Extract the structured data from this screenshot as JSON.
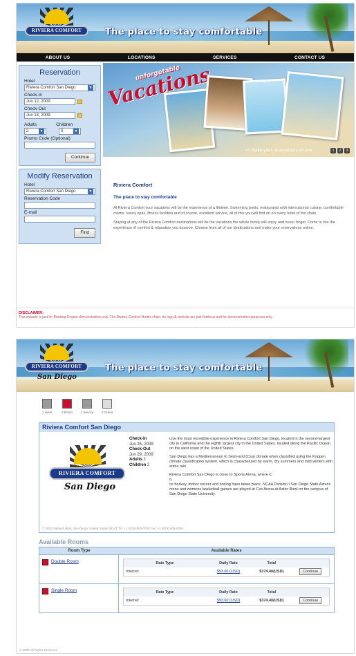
{
  "brand": {
    "name": "RIVIERA COMFORT",
    "tagline": "The place to stay comfortable",
    "city": "San Diego"
  },
  "nav": [
    "ABOUT US",
    "LOCATIONS",
    "SERVICES",
    "CONTACT US"
  ],
  "reservation": {
    "title": "Reservation",
    "hotel_label": "Hotel",
    "hotel_value": "Riviera Comfort San Diego",
    "checkin_label": "Check-In",
    "checkin_value": "Jun 12, 2009",
    "checkout_label": "Check-Out",
    "checkout_value": "Jun 13, 2009",
    "adults_label": "Adults",
    "adults_value": "2",
    "children_label": "Children",
    "children_value": "0",
    "promo_label": "Promo Code (Optional)",
    "continue": "Continue"
  },
  "modify": {
    "title": "Modify Reservation",
    "hotel_label": "Hotel",
    "hotel_value": "Riviera Comfort San Diego",
    "code_label": "Reservation Code",
    "email_label": "E-mail",
    "find": "Find"
  },
  "banner": {
    "unforgettable": "unforgetable",
    "vacations": "Vacations",
    "cta": ">> Make your reservations on-line",
    "pages": [
      "1",
      "2",
      "3"
    ]
  },
  "content": {
    "heading": "Riviera Comfort",
    "subheading": "The place to stay comfortable",
    "p1": "At Riviera Comfort your vacations will be the experience of a lifetime. Swimming pools, restaurants with international cuisine, comfortable rooms, luxury spas, fitness facilities and of course, excellent service, all of this you will find on on every hotel of the chain.",
    "p2": "Staying at any of the Riviera Comfort destinations will be the vacations the whole family will enjoy and never forget. Come to live the experience of comfort & relaxation you deserve. Choose from all of our destinations and make your reservations online."
  },
  "disclaimer": {
    "title": "DISCLAIMER:",
    "text": "This website is just for Booking Engine demonstration only. The Riviera Comfort Hotels chain, its logo & website are just fictitious and for demonstration purposes only."
  },
  "steps": [
    "1 Hotel",
    "2 Room",
    "3 Service",
    "4 Guest"
  ],
  "hotel": {
    "title": "Riviera Comfort San Diego",
    "checkin_label": "Check-In",
    "checkin": "Jun 25, 2009",
    "checkout_label": "Check-Out",
    "checkout": "Jun 29, 2009",
    "adults_label": "Adults",
    "adults": "2",
    "children_label": "Children",
    "children": "2",
    "d1": "Live the most incredible experience in Riviera Comfort San Diego, located in the second-largest city in California and the eighth largest city in the United States, located along the Pacific Ocean on the west coast of the United States.",
    "d2": "San Diego has a Mediterranean to Semi-arid (Csa) climate when classified using the Koppen climate classification system, which is characterized by warm, dry summers and mild winters with some rain.",
    "d3": "Riviera Comfort San Diego is close to Sports Arena, where ic",
    "d4": "q",
    "d5": "ce hockey, indoor soccer and boxing have taken place. NCAA Division I San Diego State Aztecs mens and womens basketball games are played at Cox Arena at Aztec Bowl on the campus of San Diego State University.",
    "address": "© 2002 Wabash Blvd, San Diego, United States 92101 Tel: +1 (619) 000-0000 Fax: +1 (619) 000-0000"
  },
  "rooms": {
    "heading": "Available Rooms",
    "col_type": "Room Type",
    "col_rates": "Available Rates",
    "rate_type": "Rate Type",
    "daily_rate": "Daily Rate",
    "total": "Total",
    "list": [
      {
        "name": "Double Room",
        "rate": "Internet",
        "daily": "$93.60 (USD)",
        "total": "$374.40(USD)",
        "btn": "Continue"
      },
      {
        "name": "Single Room",
        "rate": "Internet",
        "daily": "$93.60 (USD)",
        "total": "$374.40(USD)",
        "btn": "Continue"
      }
    ]
  },
  "footer": "© 2009 All Rights Reserved"
}
